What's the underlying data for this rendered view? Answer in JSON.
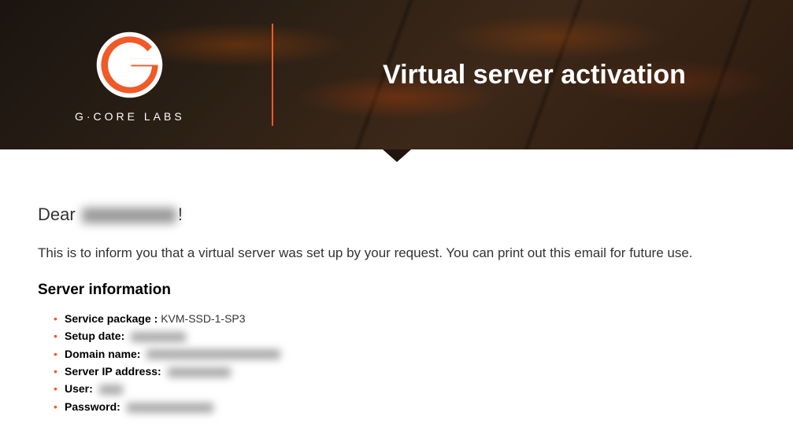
{
  "brand": {
    "name": "G·CORE LABS",
    "accent_color": "#f05a28"
  },
  "header": {
    "title": "Virtual server activation"
  },
  "greeting": {
    "prefix": "Dear",
    "suffix": "!"
  },
  "intro_text": "This is to inform you that a virtual server was set up by your request. You can print out this email for future use.",
  "server_info": {
    "heading": "Server information",
    "items": [
      {
        "label": "Service package :",
        "value": "KVM-SSD-1-SP3",
        "redacted": false
      },
      {
        "label": "Setup date:",
        "value": "",
        "redacted": true,
        "redact_class": "rw-70"
      },
      {
        "label": "Domain name:",
        "value": "",
        "redacted": true,
        "redact_class": "rw-170"
      },
      {
        "label": "Server IP address:",
        "value": "",
        "redacted": true,
        "redact_class": "rw-80"
      },
      {
        "label": "User:",
        "value": "",
        "redacted": true,
        "redact_class": "rw-30"
      },
      {
        "label": "Password:",
        "value": "",
        "redacted": true,
        "redact_class": "rw-110"
      }
    ]
  }
}
